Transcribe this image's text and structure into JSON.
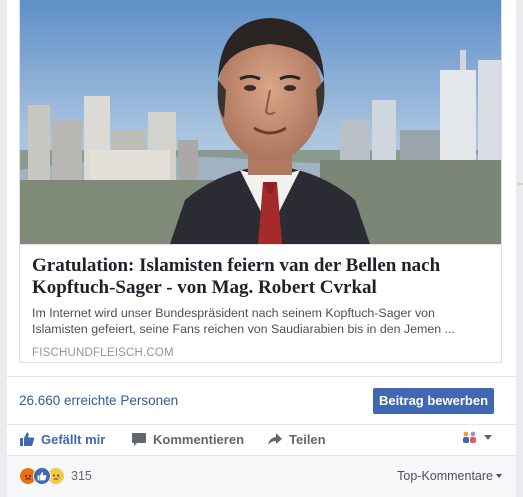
{
  "link_preview": {
    "title": "Gratulation: Islamisten feiern van der Bellen nach Kopftuch-Sager - von Mag. Robert Cvrkal",
    "description": "Im Internet wird unser Bundespräsident nach seinem Kopftuch-Sager von Islamisten gefeiert, seine Fans reichen von Saudiarabien bis in den Jemen ...",
    "domain": "FISCHUNDFLEISCH.COM",
    "image_icon": "person-portrait-image"
  },
  "insights": {
    "reach_text": "26.660 erreichte Personen",
    "boost_label": "Beitrag bewerben"
  },
  "actions": {
    "like_label": "Gefällt mir",
    "comment_label": "Kommentieren",
    "share_label": "Teilen",
    "like_icon": "thumbs-up-icon",
    "comment_icon": "speech-bubble-icon",
    "share_icon": "share-arrow-icon"
  },
  "summary": {
    "reaction_count": "315",
    "sort_label": "Top-Kommentare",
    "reactions": [
      "angry",
      "like",
      "sad"
    ]
  },
  "colors": {
    "link": "#365899",
    "button": "#4267b2",
    "text": "#1d2129"
  }
}
